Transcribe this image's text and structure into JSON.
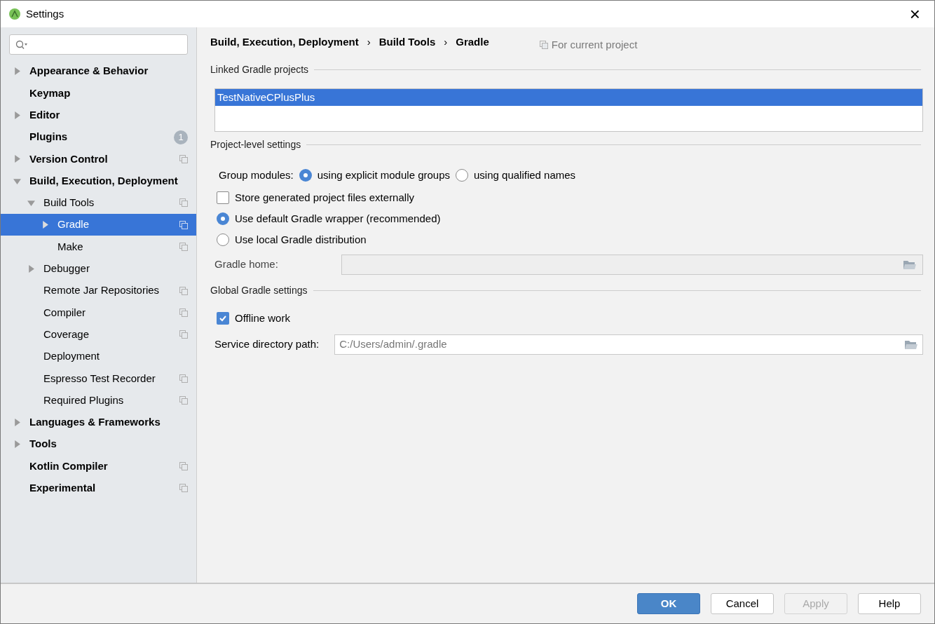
{
  "window": {
    "title": "Settings",
    "close": "×"
  },
  "sidebar": {
    "items": [
      {
        "label": "Appearance & Behavior",
        "expanded": false,
        "selected": false
      },
      {
        "label": "Keymap",
        "selected": false
      },
      {
        "label": "Editor",
        "expanded": false,
        "selected": false
      },
      {
        "label": "Plugins",
        "selected": false,
        "badge": "1"
      },
      {
        "label": "Version Control",
        "expanded": false,
        "selected": false,
        "project_scoped": true
      },
      {
        "label": "Build, Execution, Deployment",
        "expanded": true,
        "selected": false,
        "children": [
          {
            "label": "Build Tools",
            "expanded": true,
            "selected": false,
            "project_scoped": true,
            "children": [
              {
                "label": "Gradle",
                "expanded": false,
                "selected": true,
                "project_scoped": true
              },
              {
                "label": "Make",
                "selected": false,
                "project_scoped": true
              }
            ]
          },
          {
            "label": "Debugger",
            "expanded": false,
            "selected": false
          },
          {
            "label": "Remote Jar Repositories",
            "selected": false,
            "project_scoped": true
          },
          {
            "label": "Compiler",
            "selected": false,
            "project_scoped": true
          },
          {
            "label": "Coverage",
            "selected": false,
            "project_scoped": true
          },
          {
            "label": "Deployment",
            "selected": false
          },
          {
            "label": "Espresso Test Recorder",
            "selected": false,
            "project_scoped": true
          },
          {
            "label": "Required Plugins",
            "selected": false,
            "project_scoped": true
          }
        ]
      },
      {
        "label": "Languages & Frameworks",
        "expanded": false,
        "selected": false
      },
      {
        "label": "Tools",
        "expanded": false,
        "selected": false
      },
      {
        "label": "Kotlin Compiler",
        "selected": false,
        "project_scoped": true
      },
      {
        "label": "Experimental",
        "selected": false,
        "project_scoped": true
      }
    ]
  },
  "breadcrumb": {
    "items": [
      "Build, Execution, Deployment",
      "Build Tools",
      "Gradle"
    ],
    "separator": "›",
    "scope": "For current project"
  },
  "linked_projects": {
    "title": "Linked Gradle projects",
    "items": [
      {
        "label": "TestNativeCPlusPlus",
        "selected": true
      }
    ]
  },
  "project_settings": {
    "title": "Project-level settings",
    "group_modules": {
      "label": "Group modules:",
      "options": [
        {
          "label": "using explicit module groups",
          "selected": true
        },
        {
          "label": "using qualified names",
          "selected": false
        }
      ]
    },
    "options": [
      {
        "kind": "checkbox",
        "label": "Store generated project files externally",
        "checked": false
      },
      {
        "kind": "radio",
        "label": "Use default Gradle wrapper (recommended)",
        "checked": true
      },
      {
        "kind": "radio",
        "label": "Use local Gradle distribution",
        "checked": false
      }
    ],
    "gradle_home": {
      "label": "Gradle home:",
      "disabled": true
    }
  },
  "global_settings": {
    "title": "Global Gradle settings",
    "offline_work": {
      "label": "Offline work",
      "checked": true
    },
    "service_directory": {
      "label": "Service directory path:",
      "value": "C:/Users/admin/.gradle"
    }
  },
  "buttons": [
    {
      "label": "OK",
      "primary": true
    },
    {
      "label": "Cancel"
    },
    {
      "label": "Apply",
      "disabled": true
    },
    {
      "label": "Help"
    }
  ]
}
